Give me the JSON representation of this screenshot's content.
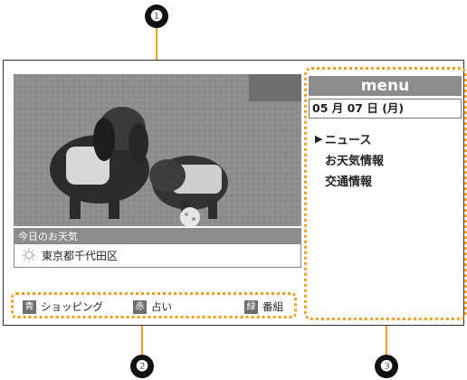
{
  "callouts": [
    "❶",
    "❷",
    "❸"
  ],
  "weather": {
    "title": "今日のお天気",
    "location": "東京都千代田区",
    "icon": "sun-icon"
  },
  "color_buttons": [
    {
      "badge": "青",
      "label": "ショッピング"
    },
    {
      "badge": "赤",
      "label": "占い"
    },
    {
      "badge": "緑",
      "label": "番組"
    }
  ],
  "menu": {
    "header": "menu",
    "date": "05 月 07 日 (月)",
    "selected_marker": "▶",
    "items": [
      "ニュース",
      "お天気情報",
      "交通情報"
    ]
  },
  "colors": {
    "highlight": "#f0a020",
    "panel_gray": "#8c8c8c"
  }
}
